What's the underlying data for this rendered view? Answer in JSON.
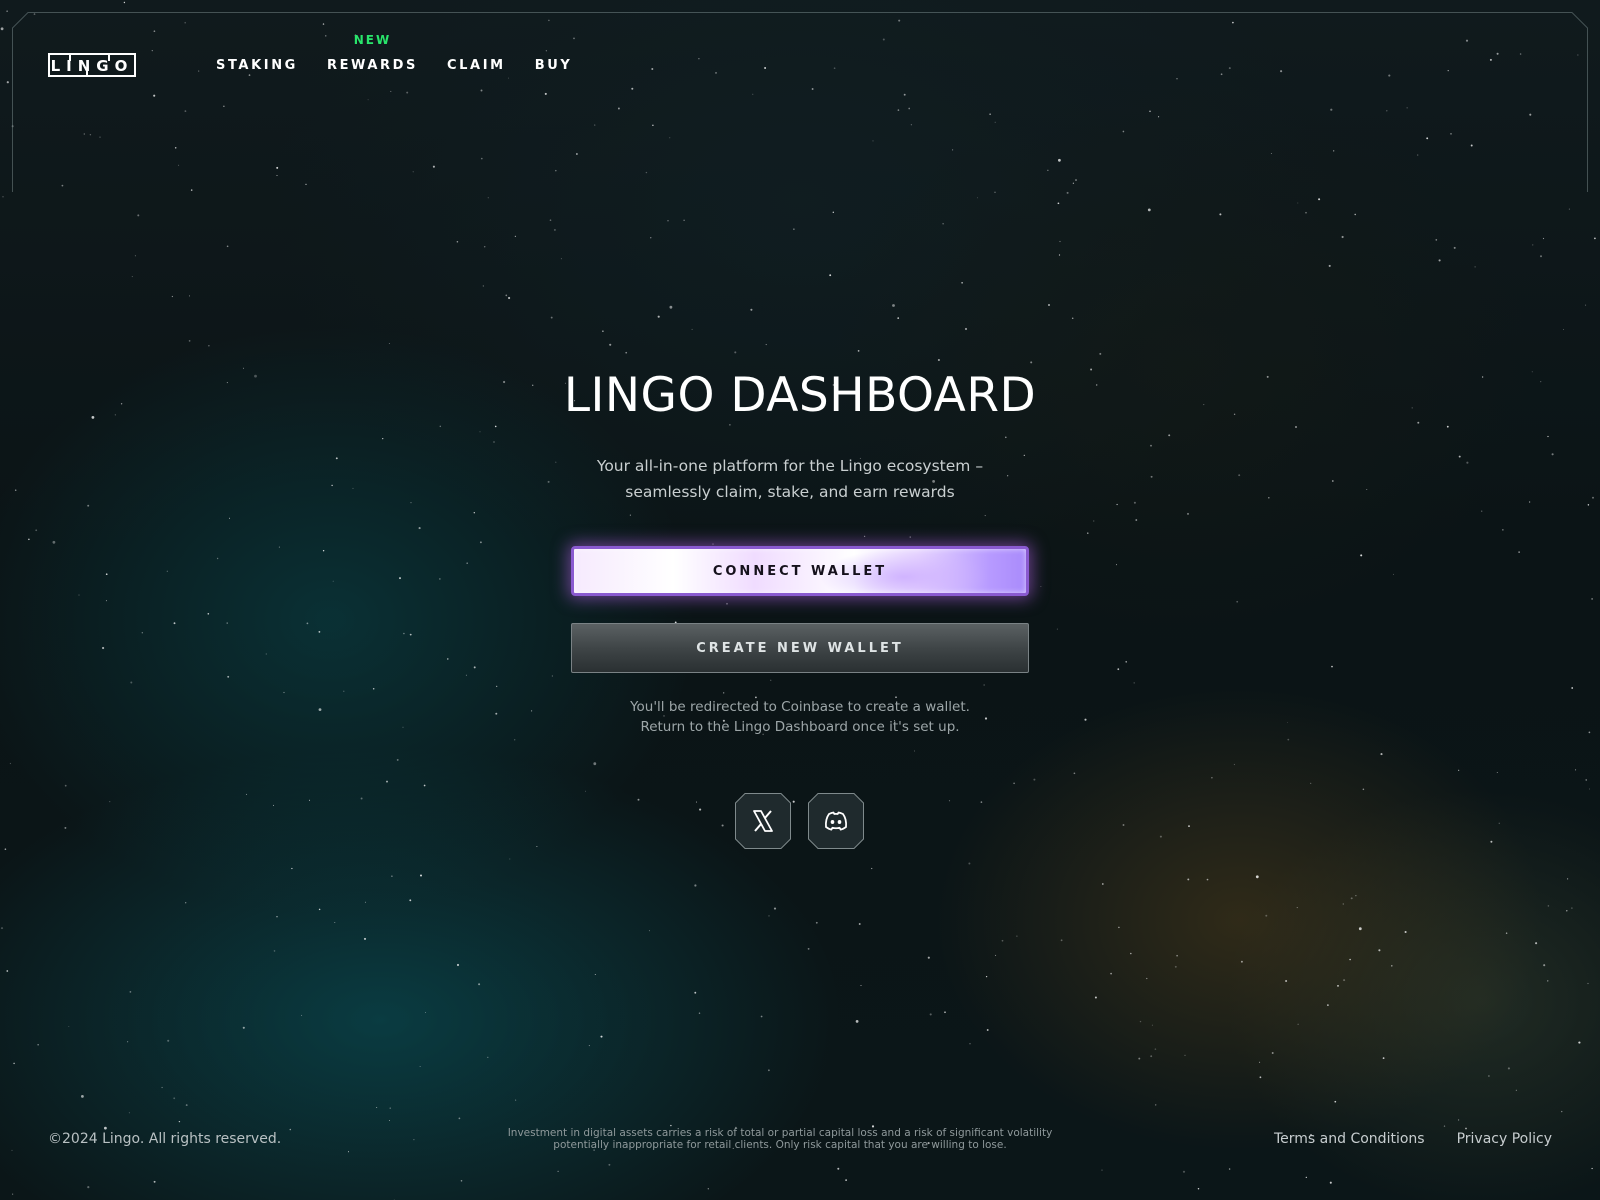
{
  "brand": {
    "logo_text": "LINGO"
  },
  "nav": {
    "items": [
      {
        "label": "STAKING",
        "badge": ""
      },
      {
        "label": "REWARDS",
        "badge": "NEW"
      },
      {
        "label": "CLAIM",
        "badge": ""
      },
      {
        "label": "BUY",
        "badge": ""
      }
    ]
  },
  "hero": {
    "title": "LINGO DASHBOARD",
    "subtitle_line1": "Your all-in-one platform for the Lingo ecosystem –",
    "subtitle_line2": "seamlessly claim, stake, and earn rewards",
    "connect_label": "CONNECT WALLET",
    "create_label": "CREATE NEW WALLET",
    "note_line1": "You'll be redirected to Coinbase to create a wallet.",
    "note_line2": "Return to the Lingo Dashboard once it's set up."
  },
  "social": {
    "items": [
      {
        "name": "x-icon"
      },
      {
        "name": "discord-icon"
      }
    ]
  },
  "footer": {
    "copyright": "©2024 Lingo. All rights reserved.",
    "disclaimer_line1": "Investment in digital assets carries a risk of total or partial capital loss and a risk of significant volatility",
    "disclaimer_line2": "potentially inappropriate for retail clients. Only risk capital that you are willing to lose.",
    "terms_label": "Terms and Conditions",
    "privacy_label": "Privacy Policy"
  },
  "colors": {
    "badge_green": "#29e56b",
    "connect_border": "#8a5ad0",
    "accent_purple": "#b79aff"
  }
}
